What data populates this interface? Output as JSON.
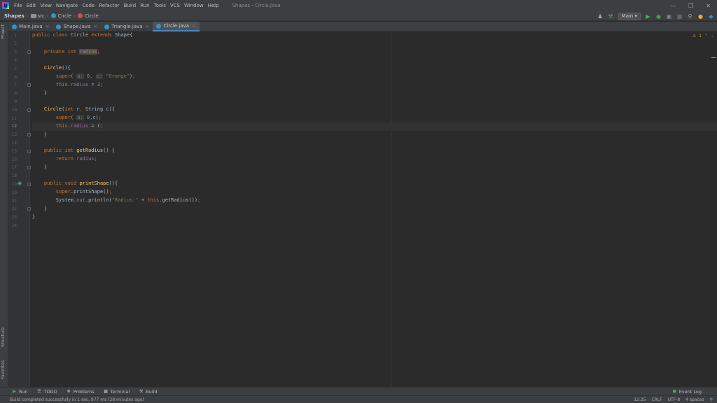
{
  "menubar": {
    "items": [
      "File",
      "Edit",
      "View",
      "Navigate",
      "Code",
      "Refactor",
      "Build",
      "Run",
      "Tools",
      "VCS",
      "Window",
      "Help"
    ],
    "window_title": "Shapes - Circle.java",
    "controls": [
      "minimize-icon",
      "restore-icon",
      "close-icon"
    ]
  },
  "navbar": {
    "project": "Shapes",
    "folder": "src",
    "crumb_class": "Circle",
    "crumb_member": "Circle",
    "run_config": "Main"
  },
  "tabs": [
    {
      "label": "Main.java",
      "active": false
    },
    {
      "label": "Shape.java",
      "active": false
    },
    {
      "label": "Triangle.java",
      "active": false
    },
    {
      "label": "Circle.java",
      "active": true
    }
  ],
  "side_labels": {
    "project": "Project",
    "structure": "Structure",
    "favorites": "Favorites"
  },
  "editor": {
    "inspection_count": "1",
    "current_line": 12,
    "line_numbers": [
      "1",
      "2",
      "3",
      "4",
      "5",
      "6",
      "7",
      "8",
      "9",
      "10",
      "11",
      "12",
      "13",
      "14",
      "15",
      "16",
      "17",
      "18",
      "19",
      "20",
      "21",
      "22",
      "23",
      "24"
    ]
  },
  "bottom_tools": {
    "run": "Run",
    "todo": "TODO",
    "problems": "Problems",
    "terminal": "Terminal",
    "build": "Build",
    "event_log": "Event Log"
  },
  "status": {
    "message": "Build completed successfully in 1 sec, 977 ms (28 minutes ago)",
    "position": "12:25",
    "line_sep": "CRLF",
    "encoding": "UTF-8",
    "indent": "4 spaces"
  },
  "colors": {
    "keyword": "#cc7832",
    "function": "#ffc66d",
    "string": "#6a8759",
    "number": "#6897bb",
    "field": "#9876aa"
  }
}
